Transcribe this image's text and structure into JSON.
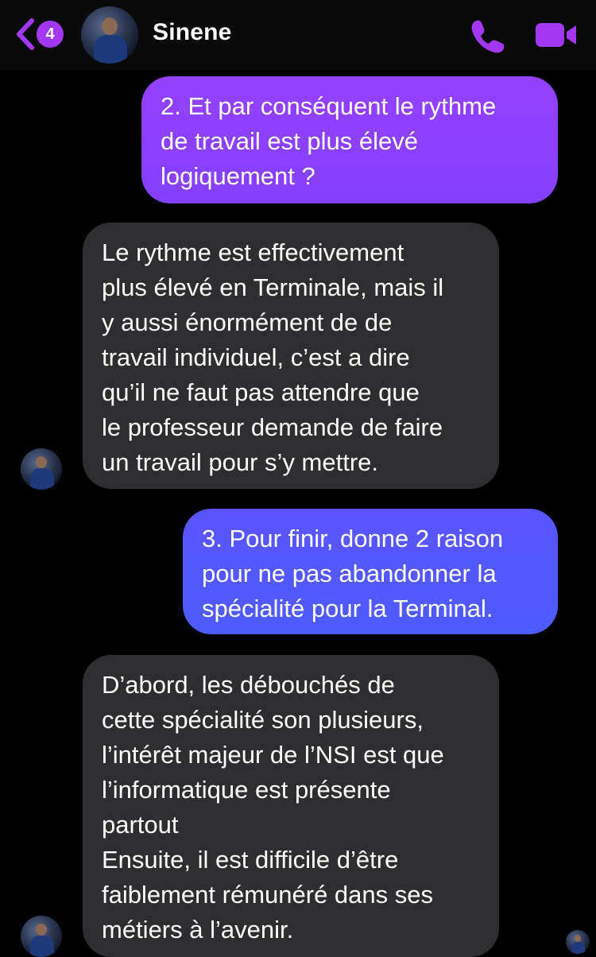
{
  "header": {
    "unread_count": "4",
    "contact_name": "Sinene",
    "accent_color": "#a238f2",
    "icons": [
      "back-chevron-icon",
      "phone-icon",
      "video-camera-icon"
    ]
  },
  "messages": [
    {
      "direction": "sent",
      "text": "2. Et par conséquent le rythme\nde travail est plus élevé\nlogiquement ?"
    },
    {
      "direction": "received",
      "text": "Le rythme est effectivement\nplus élevé en Terminale, mais il\ny aussi énormément de  de\ntravail individuel, c’est a dire\nqu’il ne faut pas attendre que\nle professeur demande de faire\nun travail pour s’y mettre."
    },
    {
      "direction": "sent",
      "text": "3. Pour finir, donne 2 raison\npour ne pas abandonner la\nspécialité pour la Terminal."
    },
    {
      "direction": "received",
      "text": "D’abord, les débouchés de\ncette spécialité son plusieurs,\nl’intérêt majeur de l’NSI est que\nl’informatique est présente\npartout\nEnsuite, il est difficile d’être\nfaiblement rémunéré dans ses\nmétiers à l’avenir."
    }
  ]
}
